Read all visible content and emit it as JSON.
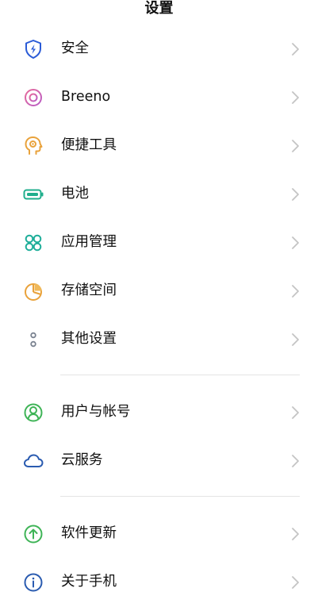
{
  "header": {
    "title": "设置"
  },
  "sections": [
    {
      "items": [
        {
          "id": "security",
          "label": "安全",
          "icon": "shield-icon",
          "color": "#2a5bd7"
        },
        {
          "id": "breeno",
          "label": "Breeno",
          "icon": "breeno-icon",
          "color": "#d4579a"
        },
        {
          "id": "convenience-tools",
          "label": "便捷工具",
          "icon": "head-icon",
          "color": "#e9a23b"
        },
        {
          "id": "battery",
          "label": "电池",
          "icon": "battery-icon",
          "color": "#1fae8c"
        },
        {
          "id": "app-management",
          "label": "应用管理",
          "icon": "apps-icon",
          "color": "#1fae9a"
        },
        {
          "id": "storage",
          "label": "存储空间",
          "icon": "pie-chart-icon",
          "color": "#e9a23b"
        },
        {
          "id": "other-settings",
          "label": "其他设置",
          "icon": "dots-icon",
          "color": "#7a8290"
        }
      ]
    },
    {
      "items": [
        {
          "id": "users-accounts",
          "label": "用户与帐号",
          "icon": "user-icon",
          "color": "#3fb457"
        },
        {
          "id": "cloud-service",
          "label": "云服务",
          "icon": "cloud-icon",
          "color": "#2a5bb0"
        }
      ]
    },
    {
      "items": [
        {
          "id": "software-update",
          "label": "软件更新",
          "icon": "arrow-up-icon",
          "color": "#3fb457"
        },
        {
          "id": "about-phone",
          "label": "关于手机",
          "icon": "info-icon",
          "color": "#2a5bb0"
        }
      ]
    }
  ],
  "colors": {
    "chevron": "#c4c4c4",
    "divider": "#e4e4e4",
    "text": "#111111"
  }
}
